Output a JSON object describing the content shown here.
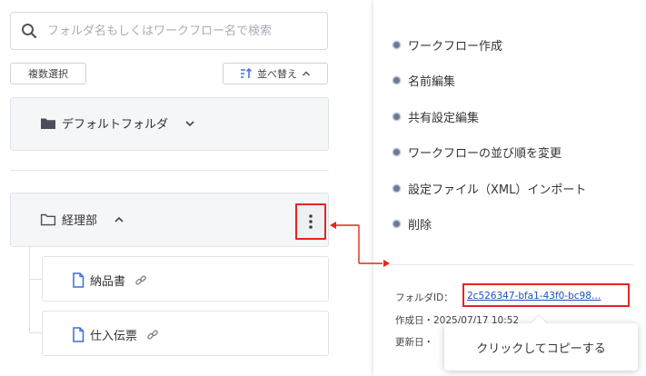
{
  "search": {
    "placeholder": "フォルダ名もしくはワークフロー名で検索"
  },
  "toolbar": {
    "multi_select_label": "複数選択",
    "sort_label": "並べ替え"
  },
  "folders": [
    {
      "name": "デフォルトフォルダ",
      "expanded": false
    },
    {
      "name": "経理部",
      "expanded": true,
      "children": [
        {
          "name": "納品書"
        },
        {
          "name": "仕入伝票"
        }
      ]
    }
  ],
  "menu": {
    "items": [
      {
        "label": "ワークフロー作成"
      },
      {
        "label": "名前編集"
      },
      {
        "label": "共有設定編集"
      },
      {
        "label": "ワークフローの並び順を変更"
      },
      {
        "label": "設定ファイル（XML）インポート"
      },
      {
        "label": "削除"
      }
    ],
    "folder_id_label": "フォルダID：",
    "folder_id_value": "2c526347-bfa1-43f0-bc98…",
    "created_label": "作成日・",
    "created_value": "2025/07/17 10:52",
    "updated_label": "更新日・"
  },
  "tooltip": {
    "text": "クリックしてコピーする"
  },
  "colors": {
    "highlight": "#e3251f",
    "accent_dot": "#6c7a96",
    "link": "#1f4fb3"
  }
}
